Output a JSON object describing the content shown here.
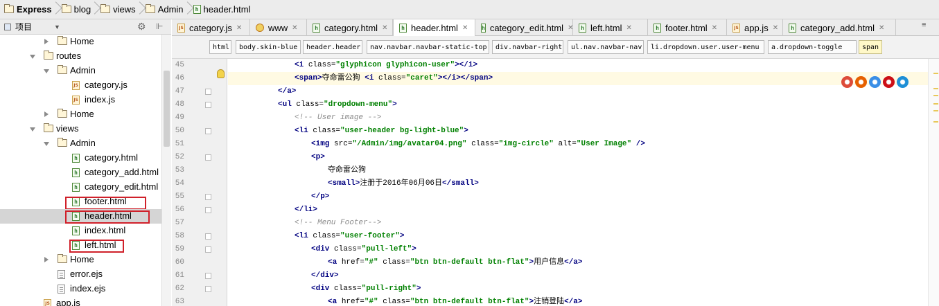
{
  "breadcrumbs": [
    "Express",
    "blog",
    "views",
    "Admin",
    "header.html"
  ],
  "project_panel": {
    "title": "项目"
  },
  "tree": [
    {
      "label": "Home",
      "type": "folder",
      "state": "collapsed"
    },
    {
      "label": "routes",
      "type": "folder",
      "state": "expanded"
    },
    {
      "label": "Admin",
      "type": "folder",
      "state": "expanded"
    },
    {
      "label": "category.js",
      "type": "js"
    },
    {
      "label": "index.js",
      "type": "js"
    },
    {
      "label": "Home",
      "type": "folder",
      "state": "collapsed"
    },
    {
      "label": "views",
      "type": "folder",
      "state": "expanded"
    },
    {
      "label": "Admin",
      "type": "folder",
      "state": "expanded"
    },
    {
      "label": "category.html",
      "type": "html"
    },
    {
      "label": "category_add.html",
      "type": "html"
    },
    {
      "label": "category_edit.html",
      "type": "html"
    },
    {
      "label": "footer.html",
      "type": "html",
      "highlighted": true
    },
    {
      "label": "header.html",
      "type": "html",
      "highlighted": true,
      "selected": true
    },
    {
      "label": "index.html",
      "type": "html"
    },
    {
      "label": "left.html",
      "type": "html",
      "highlighted": true
    },
    {
      "label": "Home",
      "type": "folder",
      "state": "collapsed"
    },
    {
      "label": "error.ejs",
      "type": "ejs"
    },
    {
      "label": "index.ejs",
      "type": "ejs"
    },
    {
      "label": "app.js",
      "type": "js"
    }
  ],
  "tabs": [
    {
      "label": "category.js",
      "type": "js"
    },
    {
      "label": "www",
      "type": "www"
    },
    {
      "label": "category.html",
      "type": "html"
    },
    {
      "label": "header.html",
      "type": "html",
      "active": true
    },
    {
      "label": "category_edit.html",
      "type": "html"
    },
    {
      "label": "left.html",
      "type": "html"
    },
    {
      "label": "footer.html",
      "type": "html"
    },
    {
      "label": "app.js",
      "type": "js"
    },
    {
      "label": "category_add.html",
      "type": "html"
    }
  ],
  "tag_crumbs": [
    "html",
    "body.skin-blue",
    "header.header",
    "nav.navbar.navbar-static-top",
    "div.navbar-right",
    "ul.nav.navbar-nav",
    "li.dropdown.user.user-menu",
    "a.dropdown-toggle",
    "span"
  ],
  "code_lines": [
    {
      "num": "45",
      "indent": 5,
      "html": "<span class='tg'>&lt;i</span> <span class='at'>class=</span><span class='st'>\"glyphicon glyphicon-user\"</span><span class='tg'>&gt;&lt;/i&gt;</span>"
    },
    {
      "num": "46",
      "indent": 5,
      "current": true,
      "html": "<span class='tg'>&lt;span</span><span class='tg'>&gt;</span><span class='tx'>夺命雷公狗</span> <span class='tg'>&lt;i</span> <span class='at'>class=</span><span class='st'>\"caret\"</span><span class='tg'>&gt;&lt;/i&gt;&lt;/span&gt;</span>"
    },
    {
      "num": "47",
      "indent": 4,
      "html": "<span class='tg'>&lt;/a&gt;</span>"
    },
    {
      "num": "48",
      "indent": 4,
      "html": "<span class='tg'>&lt;ul</span> <span class='at'>class=</span><span class='st'>\"dropdown-menu\"</span><span class='tg'>&gt;</span>"
    },
    {
      "num": "49",
      "indent": 5,
      "html": "<span class='cm'>&lt;!-- User image --&gt;</span>"
    },
    {
      "num": "50",
      "indent": 5,
      "html": "<span class='tg'>&lt;li</span> <span class='at'>class=</span><span class='st'>\"user-header bg-light-blue\"</span><span class='tg'>&gt;</span>"
    },
    {
      "num": "51",
      "indent": 6,
      "html": "<span class='tg'>&lt;img</span> <span class='at'>src=</span><span class='st'>\"/Admin/img/avatar04.png\"</span> <span class='at'>class=</span><span class='st'>\"img-circle\"</span> <span class='at'>alt=</span><span class='st'>\"User Image\"</span> <span class='tg'>/&gt;</span>"
    },
    {
      "num": "52",
      "indent": 6,
      "html": "<span class='tg'>&lt;p&gt;</span>"
    },
    {
      "num": "53",
      "indent": 7,
      "html": "<span class='tx'>夺命雷公狗</span>"
    },
    {
      "num": "54",
      "indent": 7,
      "html": "<span class='tg'>&lt;small&gt;</span><span class='tx'>注册于2016年06月06日</span><span class='tg'>&lt;/small&gt;</span>"
    },
    {
      "num": "55",
      "indent": 6,
      "html": "<span class='tg'>&lt;/p&gt;</span>"
    },
    {
      "num": "56",
      "indent": 5,
      "html": "<span class='tg'>&lt;/li&gt;</span>"
    },
    {
      "num": "57",
      "indent": 5,
      "html": "<span class='cm'>&lt;!-- Menu Footer--&gt;</span>"
    },
    {
      "num": "58",
      "indent": 5,
      "html": "<span class='tg'>&lt;li</span> <span class='at'>class=</span><span class='st'>\"user-footer\"</span><span class='tg'>&gt;</span>"
    },
    {
      "num": "59",
      "indent": 6,
      "html": "<span class='tg'>&lt;div</span> <span class='at'>class=</span><span class='st'>\"pull-left\"</span><span class='tg'>&gt;</span>"
    },
    {
      "num": "60",
      "indent": 7,
      "html": "<span class='tg'>&lt;a</span> <span class='at'>href=</span><span class='st'>\"#\"</span> <span class='at'>class=</span><span class='st'>\"btn btn-default btn-flat\"</span><span class='tg'>&gt;</span><span class='tx'>用户信息</span><span class='tg'>&lt;/a&gt;</span>"
    },
    {
      "num": "61",
      "indent": 6,
      "html": "<span class='tg'>&lt;/div&gt;</span>"
    },
    {
      "num": "62",
      "indent": 6,
      "html": "<span class='tg'>&lt;div</span> <span class='at'>class=</span><span class='st'>\"pull-right\"</span><span class='tg'>&gt;</span>"
    },
    {
      "num": "63",
      "indent": 7,
      "html": "<span class='tg'>&lt;a</span> <span class='at'>href=</span><span class='st'>\"#\"</span> <span class='at'>class=</span><span class='st'>\"btn btn-default btn-flat\"</span><span class='tg'>&gt;</span><span class='tx'>注销登陆</span><span class='tg'>&lt;/a&gt;</span>"
    }
  ],
  "browser_icons": [
    {
      "name": "chrome-icon",
      "color": "#dd4b39"
    },
    {
      "name": "firefox-icon",
      "color": "#e66000"
    },
    {
      "name": "safari-icon",
      "color": "#3a8ee6"
    },
    {
      "name": "opera-icon",
      "color": "#cc0f16"
    },
    {
      "name": "ie-icon",
      "color": "#1e8fd6"
    }
  ],
  "colors": {
    "highlight_box": "#d0202a",
    "tag": "#000080",
    "string": "#008000",
    "comment": "#8c8c8c"
  }
}
